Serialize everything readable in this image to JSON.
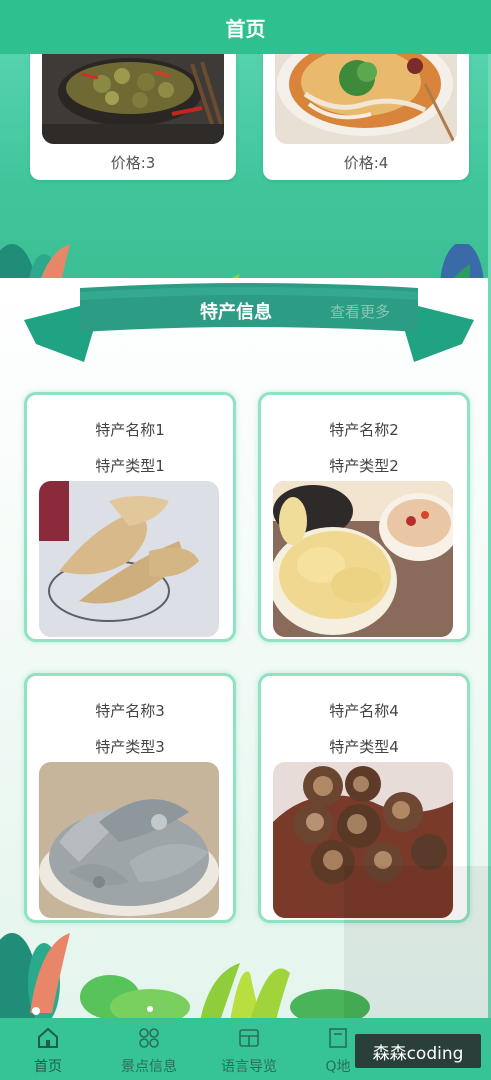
{
  "header": {
    "title": "首页"
  },
  "foods": [
    {
      "price_label": "价格:3"
    },
    {
      "price_label": "价格:4"
    }
  ],
  "specialty": {
    "section_title": "特产信息",
    "more_label": "查看更多",
    "items": [
      {
        "name": "特产名称1",
        "type": "特产类型1"
      },
      {
        "name": "特产名称2",
        "type": "特产类型2"
      },
      {
        "name": "特产名称3",
        "type": "特产类型3"
      },
      {
        "name": "特产名称4",
        "type": "特产类型4"
      }
    ]
  },
  "tabbar": {
    "items": [
      {
        "label": "首页",
        "icon": "home-icon",
        "active": true
      },
      {
        "label": "景点信息",
        "icon": "grid-icon",
        "active": false
      },
      {
        "label": "语言导览",
        "icon": "guide-icon",
        "active": false
      },
      {
        "label": "Q地",
        "icon": "map-icon",
        "active": false
      }
    ]
  },
  "watermark": "森森coding",
  "colors": {
    "primary": "#2ec08f",
    "card_border": "#8fe2c2",
    "tabbar": "#36c497"
  }
}
